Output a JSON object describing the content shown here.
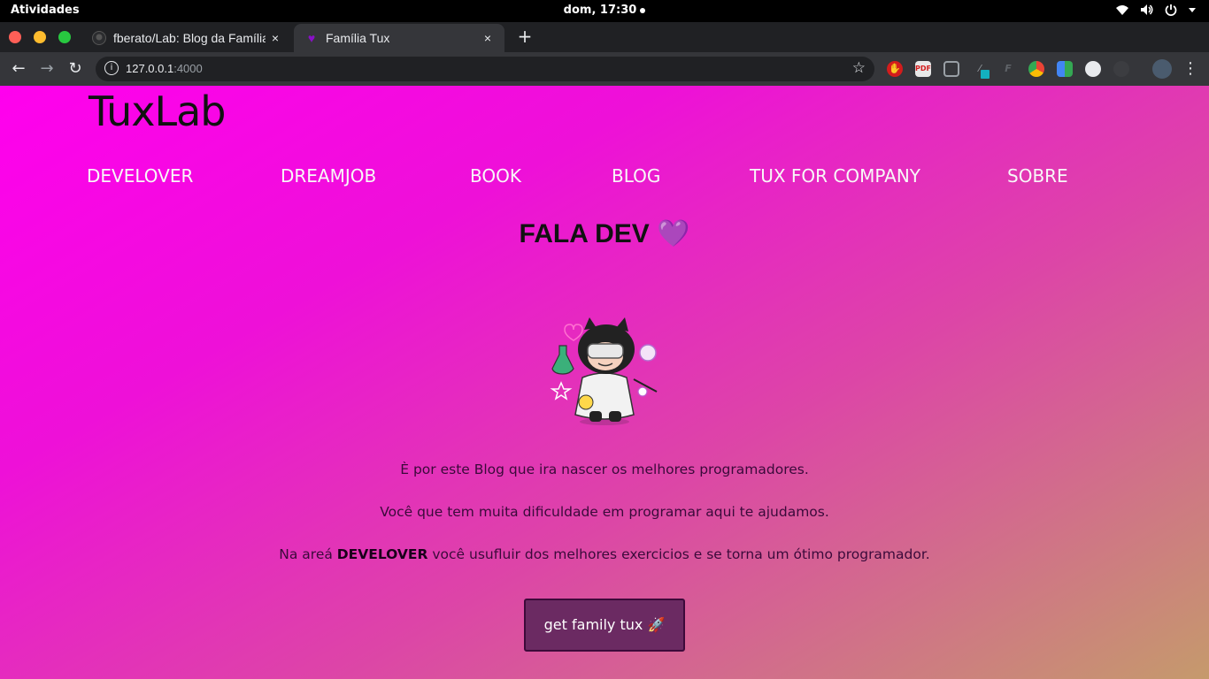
{
  "system_bar": {
    "activities": "Atividades",
    "clock": "dom, 17:30",
    "icons": [
      "wifi-icon",
      "volume-icon",
      "power-icon",
      "chevron-down-icon"
    ]
  },
  "browser": {
    "tabs": [
      {
        "title": "fberato/Lab: Blog da Família",
        "favicon": "github-icon",
        "active": false
      },
      {
        "title": "Família Tux",
        "favicon": "purple-heart-icon",
        "active": true
      }
    ],
    "tab_close_glyph": "×",
    "new_tab_glyph": "+",
    "url_host": "127.0.0.1",
    "url_port": ":4000",
    "extensions": [
      "adblock-icon",
      "pdf-icon",
      "pocket-icon",
      "eyedropper-icon",
      "font-icon",
      "chrome-icon",
      "calendar-icon",
      "github-icon",
      "github-dark-icon",
      "profile-avatar",
      "menu-icon"
    ]
  },
  "page": {
    "logo": "TuxLab",
    "nav": [
      "DEVELOVER",
      "DREAMJOB",
      "BOOK",
      "BLOG",
      "TUX FOR COMPANY",
      "SOBRE"
    ],
    "headline": "FALA DEV",
    "headline_emoji": "💜",
    "paragraphs": {
      "p1": "È por este Blog que ira nascer os melhores programadores.",
      "p2": "Você que tem muita dificuldade em programar aqui te ajudamos.",
      "p3_before": "Na areá ",
      "p3_bold": "DEVELOVER",
      "p3_after": " você usufluir dos melhores exercicios e se torna um ótimo programador."
    },
    "cta_label": "get family tux 🚀"
  },
  "colors": {
    "gradient_start": "#ff00ee",
    "gradient_end": "#c59a6c",
    "cta_bg": "#6b2a62",
    "heart": "#8a10c8"
  }
}
